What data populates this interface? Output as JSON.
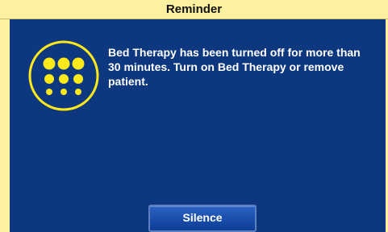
{
  "dialog": {
    "title": "Reminder",
    "message": "Bed Therapy has been turned off for more than 30 minutes. Turn on Bed Therapy or remove patient.",
    "icon": "bed-therapy-dots-icon",
    "silence_label": "Silence"
  },
  "colors": {
    "title_bar": "#fdf0a0",
    "panel": "#0d3880",
    "icon": "#fde81a",
    "text": "#ffffff"
  }
}
